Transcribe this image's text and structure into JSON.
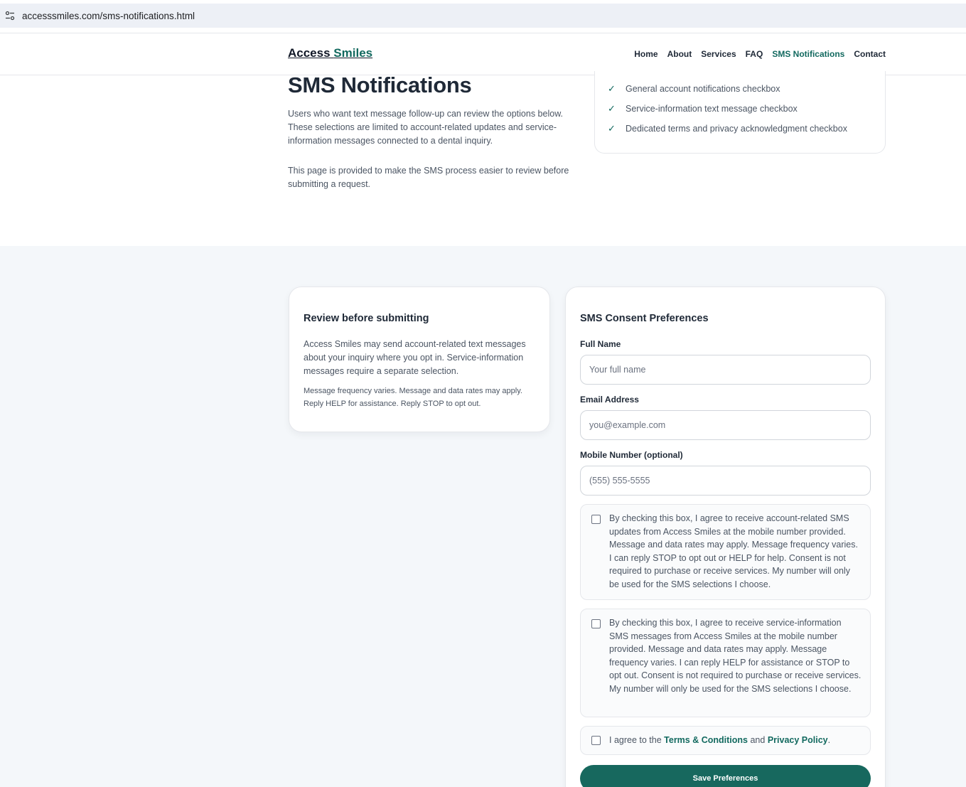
{
  "browser": {
    "url": "accesssmiles.com/sms-notifications.html",
    "site_info_icon": "tune-icon"
  },
  "header": {
    "logo_part1": "Access",
    "logo_part2": "Smiles",
    "nav": [
      "Home",
      "About",
      "Services",
      "FAQ",
      "SMS Notifications",
      "Contact"
    ],
    "active_nav": "SMS Notifications"
  },
  "hero": {
    "title": "SMS Notifications",
    "paragraph1": "Users who want text message follow-up can review the options below. These selections are limited to account-related updates and service-information messages connected to a dental inquiry.",
    "paragraph2": "This page is provided to make the SMS process easier to review before submitting a request.",
    "checklist": [
      "General account notifications checkbox",
      "Service-information text message checkbox",
      "Dedicated terms and privacy acknowledgment checkbox"
    ],
    "check_glyph": "✓"
  },
  "review": {
    "title": "Review before submitting",
    "paragraph1": "Access Smiles may send account-related text messages about your inquiry where you opt in. Service-information messages require a separate selection.",
    "paragraph2": "Message frequency varies. Message and data rates may apply. Reply HELP for assistance. Reply STOP to opt out."
  },
  "form": {
    "title": "SMS Consent Preferences",
    "full_name_label": "Full Name",
    "full_name_placeholder": "Your full name",
    "email_label": "Email Address",
    "email_placeholder": "you@example.com",
    "mobile_label": "Mobile Number (optional)",
    "mobile_placeholder": "(555) 555-5555",
    "consent_account": "By checking this box, I agree to receive account-related SMS updates from Access Smiles at the mobile number provided. Message and data rates may apply. Message frequency varies. I can reply STOP to opt out or HELP for help. Consent is not required to purchase or receive services. My number will only be used for the SMS selections I choose.",
    "consent_service": "By checking this box, I agree to receive service-information SMS messages from Access Smiles at the mobile number provided. Message and data rates may apply. Message frequency varies. I can reply HELP for assistance or STOP to opt out. Consent is not required to purchase or receive services. My number will only be used for the SMS selections I choose.",
    "terms_prefix": "I agree to the",
    "terms_link": "Terms & Conditions",
    "terms_and": "and",
    "privacy_link": "Privacy Policy",
    "terms_suffix": ".",
    "save_label": "Save Preferences"
  },
  "colors": {
    "brand": "#12695f",
    "section_bg": "#f4f7fa"
  }
}
